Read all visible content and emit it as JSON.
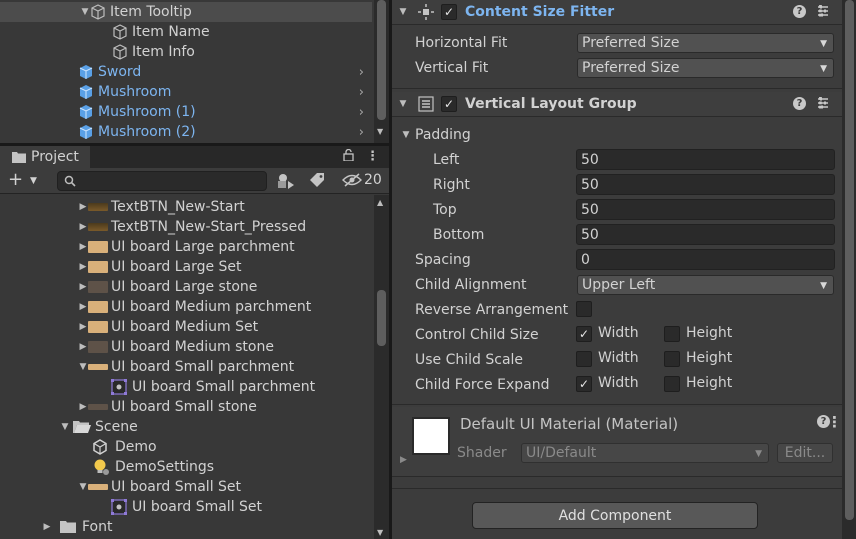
{
  "hierarchy": {
    "rows": [
      {
        "label": "Item Tooltip",
        "expanded": true,
        "selected": true,
        "blue": false
      },
      {
        "label": "Item Name",
        "blue": false
      },
      {
        "label": "Item Info",
        "blue": false
      },
      {
        "label": "Sword",
        "blue": true
      },
      {
        "label": "Mushroom",
        "blue": true
      },
      {
        "label": "Mushroom (1)",
        "blue": true
      },
      {
        "label": "Mushroom (2)",
        "blue": true
      }
    ]
  },
  "project": {
    "tab_label": "Project",
    "hidden_count": "20",
    "search_value": "",
    "items": [
      {
        "label": "TextBTN_New-Start",
        "icon": "text-button-sprite-icon"
      },
      {
        "label": "TextBTN_New-Start_Pressed",
        "icon": "text-button-sprite-icon"
      },
      {
        "label": "UI board Large  parchment",
        "icon": "parchment-sprite-icon"
      },
      {
        "label": "UI board Large Set",
        "icon": "parchment-sprite-icon"
      },
      {
        "label": "UI board Large stone",
        "icon": "stone-sprite-icon"
      },
      {
        "label": "UI board Medium  parchment",
        "icon": "parchment-sprite-icon"
      },
      {
        "label": "UI board Medium Set",
        "icon": "parchment-sprite-icon"
      },
      {
        "label": "UI board Medium stone",
        "icon": "stone-sprite-icon"
      },
      {
        "label": "UI board Small  parchment",
        "icon": "parchment-sprite-icon"
      },
      {
        "label": "UI board Small  parchment",
        "icon": "sprite-asset-icon"
      },
      {
        "label": "UI board Small  stone",
        "icon": "stone-sprite-icon"
      },
      {
        "label": "Scene",
        "icon": "open-folder-icon"
      },
      {
        "label": "Demo",
        "icon": "unity-scene-icon"
      },
      {
        "label": "DemoSettings",
        "icon": "lighting-settings-icon"
      },
      {
        "label": "UI board Small Set",
        "icon": "parchment-sprite-icon"
      },
      {
        "label": "UI board Small Set",
        "icon": "sprite-asset-icon"
      },
      {
        "label": "Font",
        "icon": "folder-icon"
      }
    ]
  },
  "inspector": {
    "csf": {
      "title": "Content Size Fitter",
      "horizontal_fit_label": "Horizontal Fit",
      "horizontal_fit_value": "Preferred Size",
      "vertical_fit_label": "Vertical Fit",
      "vertical_fit_value": "Preferred Size"
    },
    "vlg": {
      "title": "Vertical Layout Group",
      "padding_label": "Padding",
      "left_label": "Left",
      "left_value": "50",
      "right_label": "Right",
      "right_value": "50",
      "top_label": "Top",
      "top_value": "50",
      "bottom_label": "Bottom",
      "bottom_value": "50",
      "spacing_label": "Spacing",
      "spacing_value": "0",
      "child_alignment_label": "Child Alignment",
      "child_alignment_value": "Upper Left",
      "reverse_label": "Reverse Arrangement",
      "control_child_size_label": "Control Child Size",
      "use_child_scale_label": "Use Child Scale",
      "child_force_expand_label": "Child Force Expand",
      "width_label": "Width",
      "height_label": "Height"
    },
    "material": {
      "title": "Default UI Material (Material)",
      "shader_label": "Shader",
      "shader_value": "UI/Default",
      "edit_label": "Edit..."
    },
    "add_component_label": "Add Component"
  },
  "colors": {
    "prefab_blue": "#7db5f0",
    "title_blue": "#7db5f0"
  }
}
